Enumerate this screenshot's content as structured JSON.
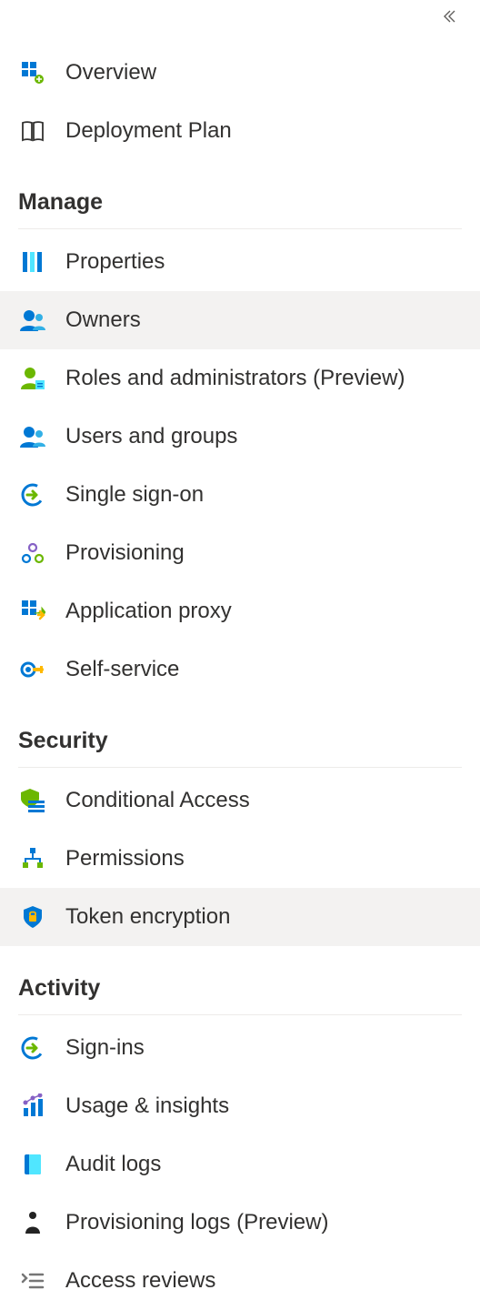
{
  "top_items": [
    {
      "id": "overview",
      "label": "Overview",
      "icon": "overview-icon"
    },
    {
      "id": "deployment-plan",
      "label": "Deployment Plan",
      "icon": "book-icon"
    }
  ],
  "sections": [
    {
      "id": "manage",
      "title": "Manage",
      "items": [
        {
          "id": "properties",
          "label": "Properties",
          "icon": "properties-icon",
          "selected": false
        },
        {
          "id": "owners",
          "label": "Owners",
          "icon": "owners-icon",
          "selected": true
        },
        {
          "id": "roles-admins",
          "label": "Roles and administrators (Preview)",
          "icon": "roles-icon",
          "selected": false
        },
        {
          "id": "users-groups",
          "label": "Users and groups",
          "icon": "users-groups-icon",
          "selected": false
        },
        {
          "id": "sso",
          "label": "Single sign-on",
          "icon": "sso-icon",
          "selected": false
        },
        {
          "id": "provisioning",
          "label": "Provisioning",
          "icon": "provisioning-icon",
          "selected": false
        },
        {
          "id": "app-proxy",
          "label": "Application proxy",
          "icon": "app-proxy-icon",
          "selected": false
        },
        {
          "id": "self-service",
          "label": "Self-service",
          "icon": "self-service-icon",
          "selected": false
        }
      ]
    },
    {
      "id": "security",
      "title": "Security",
      "items": [
        {
          "id": "conditional-access",
          "label": "Conditional Access",
          "icon": "conditional-access-icon",
          "selected": false
        },
        {
          "id": "permissions",
          "label": "Permissions",
          "icon": "permissions-icon",
          "selected": false
        },
        {
          "id": "token-encryption",
          "label": "Token encryption",
          "icon": "token-encryption-icon",
          "selected": true
        }
      ]
    },
    {
      "id": "activity",
      "title": "Activity",
      "items": [
        {
          "id": "sign-ins",
          "label": "Sign-ins",
          "icon": "sign-ins-icon",
          "selected": false
        },
        {
          "id": "usage-insights",
          "label": "Usage & insights",
          "icon": "usage-insights-icon",
          "selected": false
        },
        {
          "id": "audit-logs",
          "label": "Audit logs",
          "icon": "audit-logs-icon",
          "selected": false
        },
        {
          "id": "provisioning-logs",
          "label": "Provisioning logs (Preview)",
          "icon": "provisioning-logs-icon",
          "selected": false
        },
        {
          "id": "access-reviews",
          "label": "Access reviews",
          "icon": "access-reviews-icon",
          "selected": false
        }
      ]
    }
  ]
}
